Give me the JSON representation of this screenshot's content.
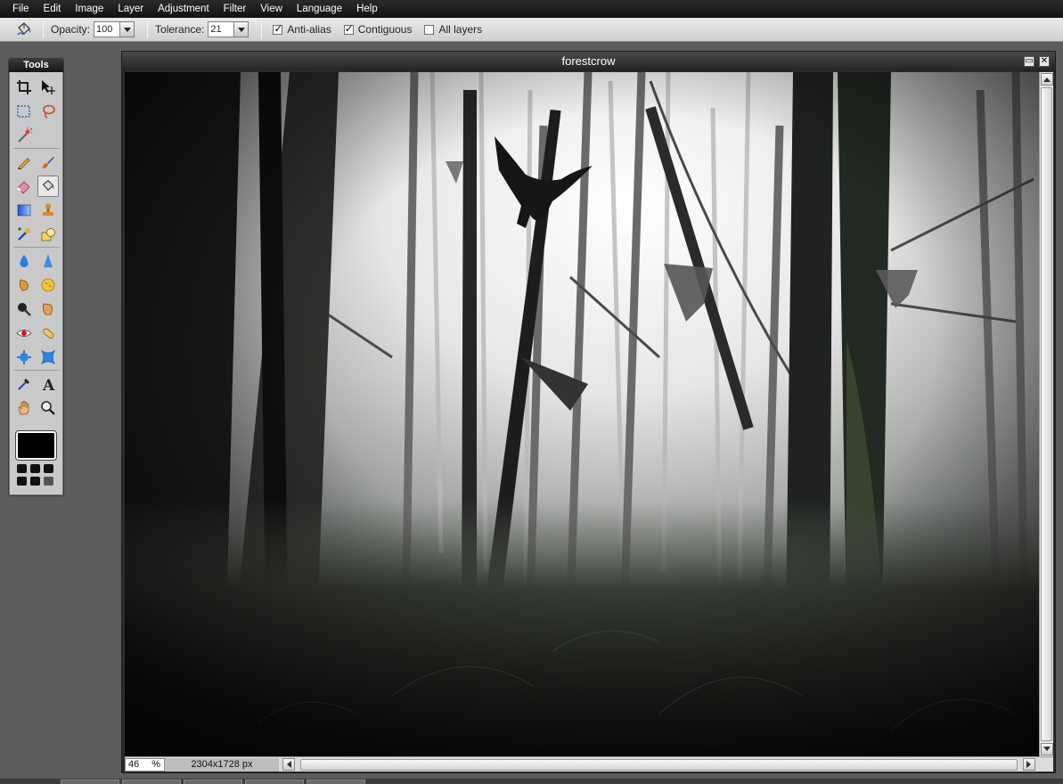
{
  "menu": {
    "items": [
      "File",
      "Edit",
      "Image",
      "Layer",
      "Adjustment",
      "Filter",
      "View",
      "Language",
      "Help"
    ]
  },
  "options": {
    "active_tool_icon": "paint-bucket-icon",
    "opacity_label": "Opacity:",
    "opacity_value": "100",
    "tolerance_label": "Tolerance:",
    "tolerance_value": "21",
    "antialias_label": "Anti-alias",
    "antialias_checked": true,
    "contiguous_label": "Contiguous",
    "contiguous_checked": true,
    "alllayers_label": "All layers",
    "alllayers_checked": false
  },
  "tools": {
    "title": "Tools",
    "items": [
      {
        "icon": "crop-icon"
      },
      {
        "icon": "move-icon"
      },
      {
        "icon": "marquee-icon"
      },
      {
        "icon": "lasso-icon"
      },
      {
        "icon": "magic-wand-icon"
      },
      {
        "icon": "pencil-icon"
      },
      {
        "icon": "brush-icon"
      },
      {
        "icon": "eraser-icon"
      },
      {
        "icon": "paint-bucket-icon"
      },
      {
        "icon": "gradient-icon"
      },
      {
        "icon": "clone-stamp-icon"
      },
      {
        "icon": "color-replace-icon"
      },
      {
        "icon": "drawing-icon"
      },
      {
        "icon": "blur-icon"
      },
      {
        "icon": "sharpen-icon"
      },
      {
        "icon": "smudge-icon"
      },
      {
        "icon": "sponge-icon"
      },
      {
        "icon": "dodge-icon"
      },
      {
        "icon": "burn-icon"
      },
      {
        "icon": "red-eye-icon"
      },
      {
        "icon": "spot-heal-icon"
      },
      {
        "icon": "bloat-icon"
      },
      {
        "icon": "pinch-icon"
      },
      {
        "icon": "color-picker-icon"
      },
      {
        "icon": "type-icon"
      },
      {
        "icon": "hand-icon"
      },
      {
        "icon": "zoom-icon"
      }
    ],
    "active_tool": "paint-bucket-icon",
    "foreground_color": "#000000",
    "background_color": "#000000"
  },
  "document": {
    "title": "forestcrow",
    "zoom": "46",
    "zoom_unit": "%",
    "dimensions": "2304x1728 px"
  },
  "colors": {
    "menubar": "#1c1c1c",
    "workspace": "#5c5c5c"
  }
}
